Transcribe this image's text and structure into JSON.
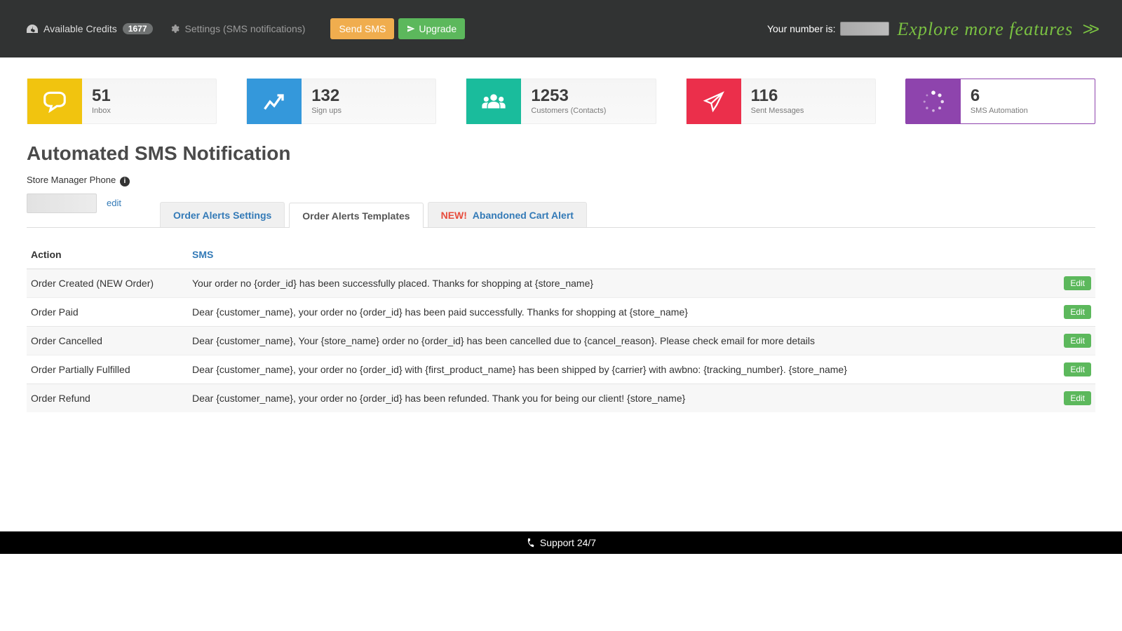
{
  "topbar": {
    "credits_label": "Available Credits",
    "credits_value": "1677",
    "settings_label": "Settings (SMS notifications)",
    "send_sms_label": "Send SMS",
    "upgrade_label": "Upgrade",
    "your_number_label": "Your number is:",
    "explore_label": "Explore more features"
  },
  "stats": [
    {
      "value": "51",
      "label": "Inbox",
      "color": "yellow"
    },
    {
      "value": "132",
      "label": "Sign ups",
      "color": "blue"
    },
    {
      "value": "1253",
      "label": "Customers (Contacts)",
      "color": "teal"
    },
    {
      "value": "116",
      "label": "Sent Messages",
      "color": "red"
    },
    {
      "value": "6",
      "label": "SMS Automation",
      "color": "purple",
      "active": true
    }
  ],
  "page_title": "Automated SMS Notification",
  "phone_section": {
    "label": "Store Manager Phone",
    "edit_label": "edit"
  },
  "tabs": {
    "settings": "Order Alerts Settings",
    "templates": "Order Alerts Templates",
    "cart_new": "NEW!",
    "cart": "Abandoned Cart Alert"
  },
  "table": {
    "headers": {
      "action": "Action",
      "sms": "SMS"
    },
    "rows": [
      {
        "action": "Order Created (NEW Order)",
        "sms": "Your order no {order_id} has been successfully placed. Thanks for shopping at {store_name}"
      },
      {
        "action": "Order Paid",
        "sms": "Dear {customer_name}, your order no {order_id} has been paid successfully. Thanks for shopping at {store_name}"
      },
      {
        "action": "Order Cancelled",
        "sms": "Dear {customer_name}, Your {store_name} order no {order_id} has been cancelled due to {cancel_reason}. Please check email for more details"
      },
      {
        "action": "Order Partially Fulfilled",
        "sms": "Dear {customer_name}, your order no {order_id} with {first_product_name} has been shipped by {carrier} with awbno: {tracking_number}. {store_name}"
      },
      {
        "action": "Order Refund",
        "sms": "Dear {customer_name}, your order no {order_id} has been refunded. Thank you for being our client! {store_name}"
      }
    ],
    "edit_label": "Edit"
  },
  "footer": {
    "label": "Support 24/7"
  }
}
